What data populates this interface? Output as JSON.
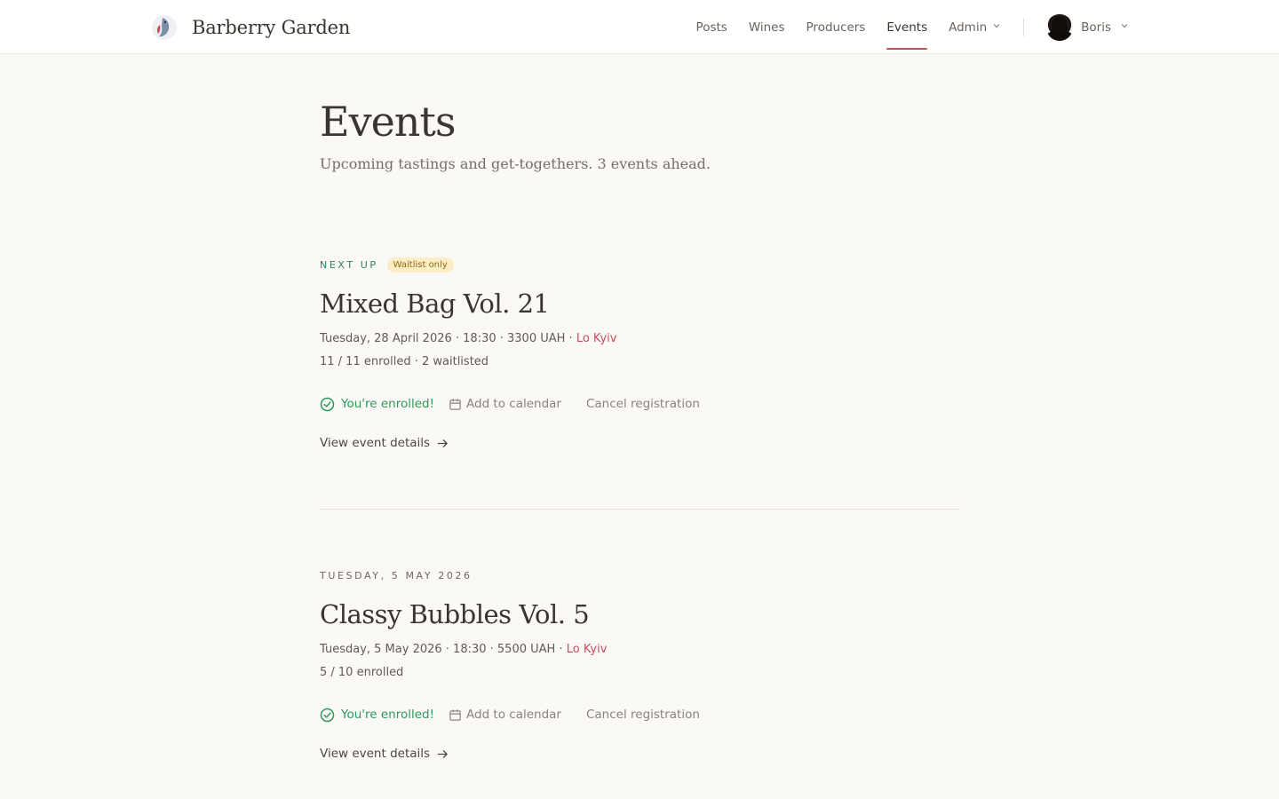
{
  "header": {
    "brand": "Barberry Garden",
    "nav": [
      "Posts",
      "Wines",
      "Producers",
      "Events",
      "Admin"
    ],
    "active_nav": "Events",
    "user": "Boris"
  },
  "page": {
    "title": "Events",
    "subtitle": "Upcoming tastings and get-togethers. 3 events ahead."
  },
  "events": [
    {
      "kicker": "Next up",
      "badge": "Waitlist only",
      "title": "Mixed Bag Vol. 21",
      "meta": "Tuesday, 28 April 2026 · 18:30 · 3300 UAH · ",
      "location": "Lo Kyiv",
      "enrollment": "11 / 11 enrolled · 2 waitlisted",
      "status": "You're enrolled!",
      "calendar": "Add to calendar",
      "cancel": "Cancel registration",
      "details": "View event details"
    },
    {
      "kicker": "Tuesday, 5 May 2026",
      "title": "Classy Bubbles Vol. 5",
      "meta": "Tuesday, 5 May 2026 · 18:30 · 5500 UAH · ",
      "location": "Lo Kyiv",
      "enrollment": "5 / 10 enrolled",
      "status": "You're enrolled!",
      "calendar": "Add to calendar",
      "cancel": "Cancel registration",
      "details": "View event details"
    }
  ]
}
